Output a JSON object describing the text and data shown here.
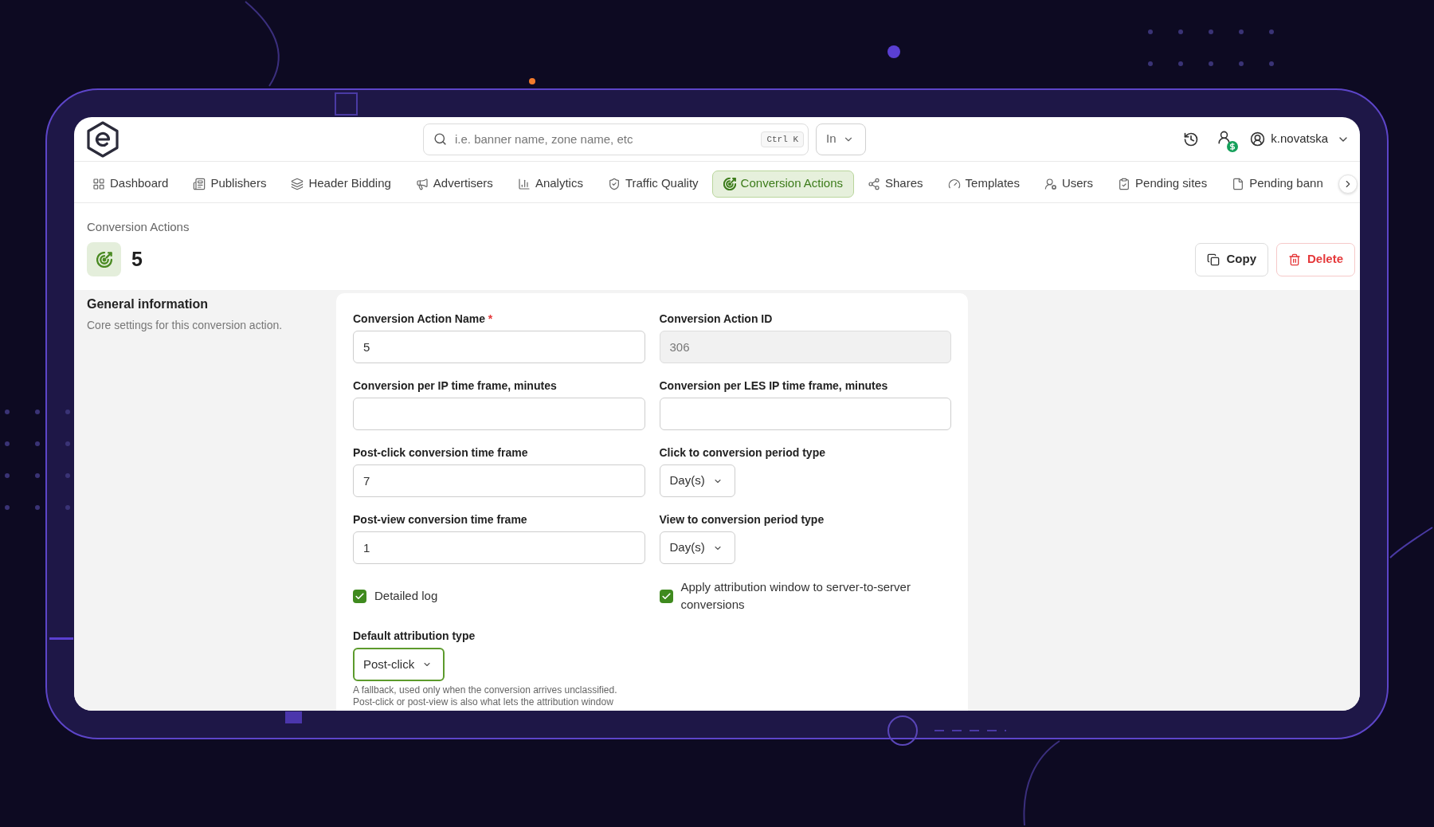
{
  "header": {
    "search": {
      "placeholder": "i.e. banner name, zone name, etc",
      "shortcut": "Ctrl K"
    },
    "scope": {
      "value": "In"
    },
    "user": {
      "name": "k.novatska"
    }
  },
  "nav_tabs": [
    {
      "label": "Dashboard",
      "selected": false
    },
    {
      "label": "Publishers",
      "selected": false
    },
    {
      "label": "Header Bidding",
      "selected": false
    },
    {
      "label": "Advertisers",
      "selected": false
    },
    {
      "label": "Analytics",
      "selected": false
    },
    {
      "label": "Traffic Quality",
      "selected": false
    },
    {
      "label": "Conversion Actions",
      "selected": true
    },
    {
      "label": "Shares",
      "selected": false
    },
    {
      "label": "Templates",
      "selected": false
    },
    {
      "label": "Users",
      "selected": false
    },
    {
      "label": "Pending sites",
      "selected": false
    },
    {
      "label": "Pending bann",
      "selected": false
    }
  ],
  "page": {
    "breadcrumb": "Conversion Actions",
    "title": "5",
    "actions": [
      {
        "label": "Copy",
        "kind": "secondary"
      },
      {
        "label": "Delete",
        "kind": "danger"
      }
    ]
  },
  "section": {
    "title": "General information",
    "description": "Core settings for this conversion action."
  },
  "form": {
    "required_mark": "*",
    "fields": [
      {
        "kind": "input",
        "label": "Conversion Action Name",
        "required": true,
        "disabled": false,
        "value": "5"
      },
      {
        "kind": "input",
        "label": "Conversion Action ID",
        "required": false,
        "disabled": true,
        "value": "306"
      },
      {
        "kind": "input",
        "label": "Conversion per IP time frame, minutes",
        "required": false,
        "disabled": false
      },
      {
        "kind": "input",
        "label": "Conversion per LES IP time frame, minutes",
        "required": false,
        "disabled": false
      },
      {
        "kind": "input",
        "label": "Post-click conversion time frame",
        "required": false,
        "disabled": false,
        "value": "7"
      },
      {
        "kind": "select",
        "label": "Click to conversion period type",
        "value": "Day(s)",
        "focused": false
      },
      {
        "kind": "input",
        "label": "Post-view conversion time frame",
        "required": false,
        "disabled": false,
        "value": "1"
      },
      {
        "kind": "select",
        "label": "View to conversion period type",
        "value": "Day(s)",
        "focused": false
      },
      {
        "kind": "checkbox",
        "label": "Detailed log",
        "checked": true
      },
      {
        "kind": "checkbox",
        "label": "Apply attribution window to server-to-server conversions",
        "checked": true
      },
      {
        "kind": "select",
        "label": "Default attribution type",
        "value": "Post-click",
        "focused": true,
        "help": "A fallback, used only when the conversion arrives unclassified. Post-click or post-view is also what lets the attribution window"
      }
    ]
  }
}
